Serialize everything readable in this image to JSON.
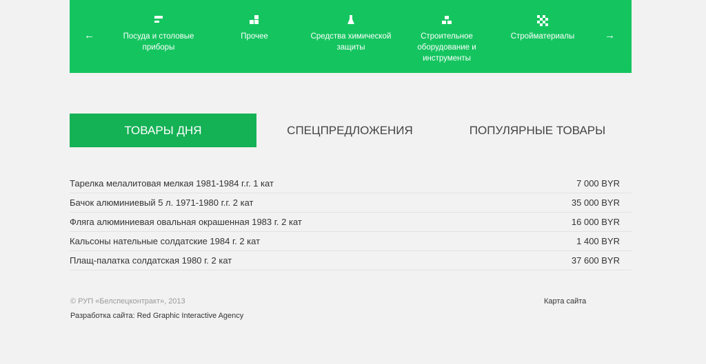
{
  "categories": {
    "prev_icon": "arrow-left-icon",
    "next_icon": "arrow-right-icon",
    "prev_glyph": "←",
    "next_glyph": "→",
    "items": [
      {
        "label": "Посуда и столовые приборы",
        "icon": "tableware-icon"
      },
      {
        "label": "Прочее",
        "icon": "blocks-icon"
      },
      {
        "label": "Средства химической защиты",
        "icon": "flask-icon"
      },
      {
        "label": "Строительное оборудование и инструменты",
        "icon": "bricks-icon"
      },
      {
        "label": "Стройматериалы",
        "icon": "checker-icon"
      }
    ]
  },
  "tabs": [
    {
      "label": "ТОВАРЫ ДНЯ",
      "active": true
    },
    {
      "label": "СПЕЦПРЕДЛОЖЕНИЯ",
      "active": false
    },
    {
      "label": "ПОПУЛЯРНЫЕ ТОВАРЫ",
      "active": false
    }
  ],
  "products": [
    {
      "name": "Тарелка мелалитовая мелкая 1981-1984 г.г. 1 кат",
      "price": "7 000 BYR"
    },
    {
      "name": "Бачок алюминиевый 5 л. 1971-1980 г.г. 2 кат",
      "price": "35 000 BYR"
    },
    {
      "name": "Фляга алюминиевая овальная окрашенная 1983 г. 2 кат",
      "price": "16 000 BYR"
    },
    {
      "name": "Кальсоны нательные солдатские 1984 г. 2 кат",
      "price": "1 400 BYR"
    },
    {
      "name": "Плащ-палатка солдатская 1980 г. 2 кат",
      "price": "37 600 BYR"
    }
  ],
  "footer": {
    "copyright": "© РУП «Белспецконтракт», 2013",
    "dev_prefix": "Разработка сайта: ",
    "dev_agency": "Red Graphic Interactive Agency",
    "sitemap": "Карта сайта"
  },
  "colors": {
    "accent": "#14c55f",
    "tab_active": "#14b155",
    "background": "#f2f2f2"
  }
}
